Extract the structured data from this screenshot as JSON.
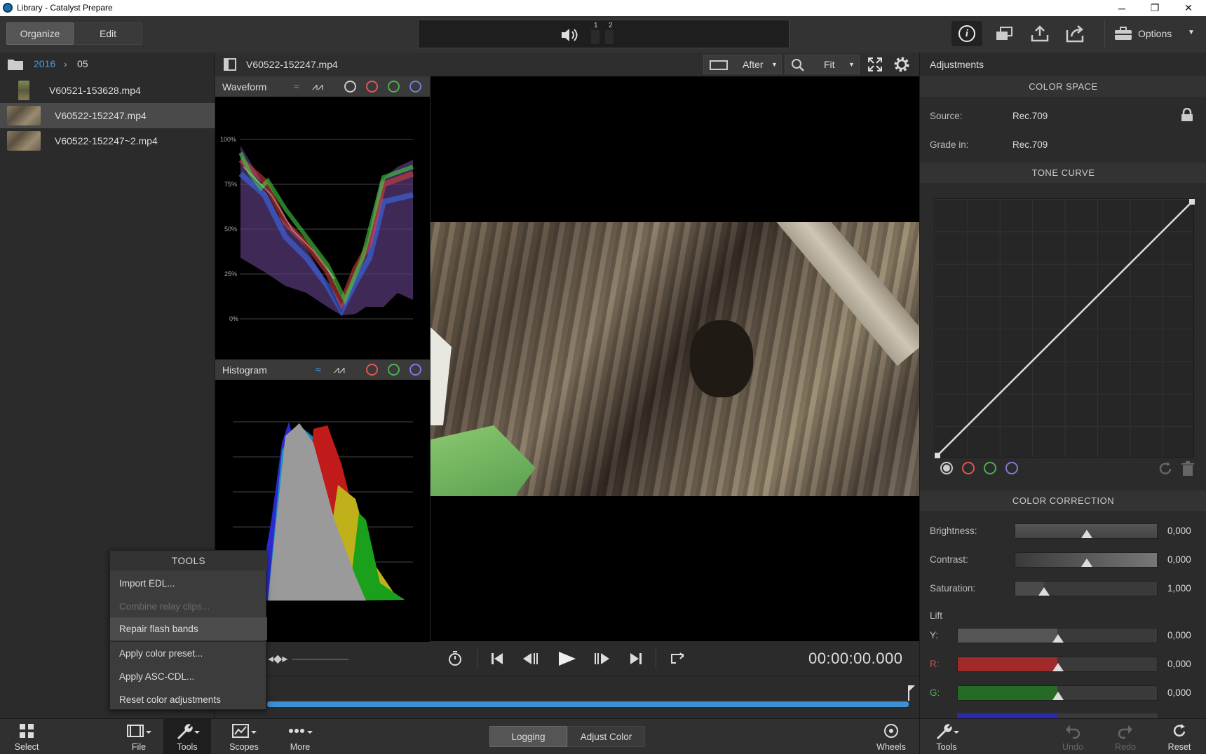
{
  "window": {
    "title": "Library - Catalyst Prepare",
    "minimize": "─",
    "maximize": "❐",
    "close": "✕"
  },
  "topbar": {
    "organize": "Organize",
    "edit": "Edit",
    "channel1": "1",
    "channel2": "2",
    "options": "Options"
  },
  "breadcrumb": {
    "year": "2016",
    "month": "05"
  },
  "files": [
    {
      "name": "V60521-153628.mp4"
    },
    {
      "name": "V60522-152247.mp4",
      "selected": true
    },
    {
      "name": "V60522-152247~2.mp4"
    }
  ],
  "viewer": {
    "clip_name": "V60522-152247.mp4",
    "view_mode": "After",
    "zoom": "Fit",
    "timecode": "00:00:00.000"
  },
  "waveform": {
    "title": "Waveform",
    "ticks": [
      "100%",
      "75%",
      "50%",
      "25%",
      "0%"
    ]
  },
  "histogram": {
    "title": "Histogram"
  },
  "adjustments": {
    "title": "Adjustments",
    "color_space": {
      "header": "COLOR SPACE",
      "source_label": "Source:",
      "source_value": "Rec.709",
      "grade_label": "Grade in:",
      "grade_value": "Rec.709"
    },
    "tone_curve": {
      "header": "TONE CURVE"
    },
    "color_correction": {
      "header": "COLOR CORRECTION",
      "brightness_label": "Brightness:",
      "brightness_value": "0,000",
      "brightness_level": 0.5,
      "contrast_label": "Contrast:",
      "contrast_value": "0,000",
      "contrast_level": 0.5,
      "saturation_label": "Saturation:",
      "saturation_value": "1,000",
      "saturation_level": 0.2
    },
    "lift": {
      "label": "Lift",
      "y_label": "Y:",
      "y_value": "0,000",
      "r_label": "R:",
      "r_value": "0,000",
      "g_label": "G:",
      "g_value": "0,000"
    }
  },
  "tools_menu": {
    "header": "TOOLS",
    "items": [
      "Import EDL...",
      "Combine relay clips...",
      "Repair flash bands",
      "Apply color preset...",
      "Apply ASC-CDL...",
      "Reset color adjustments"
    ]
  },
  "bottombar": {
    "select": "Select",
    "file": "File",
    "tools": "Tools",
    "scopes": "Scopes",
    "more": "More",
    "logging": "Logging",
    "adjust_color": "Adjust Color",
    "wheels": "Wheels",
    "tools_right": "Tools",
    "undo": "Undo",
    "redo": "Redo",
    "reset": "Reset"
  },
  "colors": {
    "accent": "#3d8fd6",
    "red": "#e05555",
    "green": "#4caf50",
    "blue": "#7b7bdc"
  }
}
